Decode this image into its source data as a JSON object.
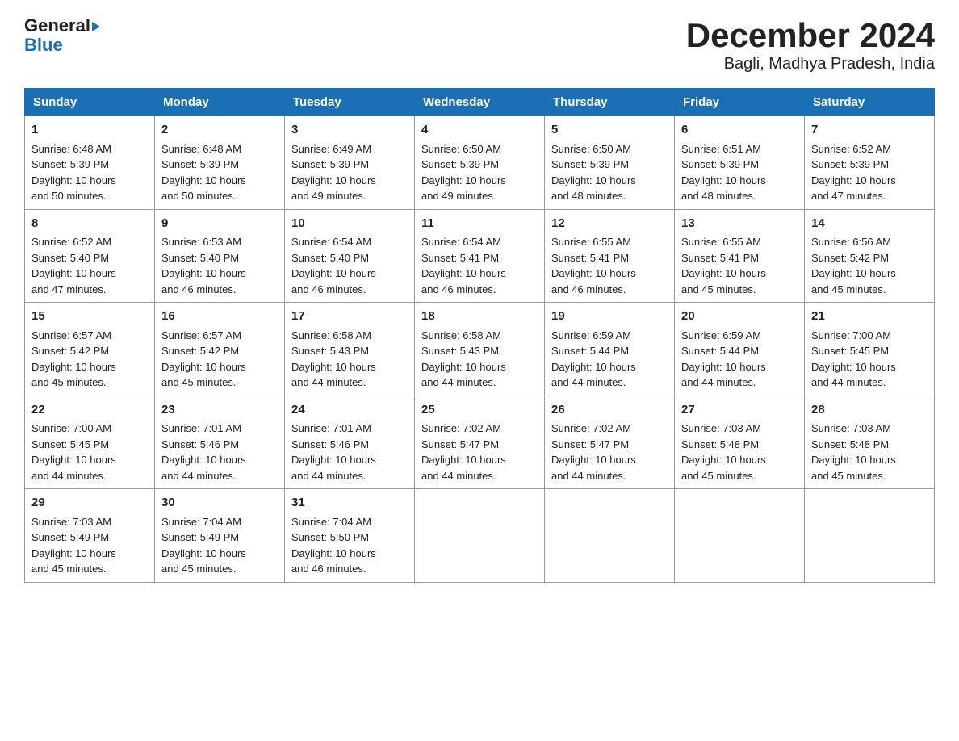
{
  "logo": {
    "general": "General",
    "blue": "Blue"
  },
  "title": "December 2024",
  "subtitle": "Bagli, Madhya Pradesh, India",
  "weekdays": [
    "Sunday",
    "Monday",
    "Tuesday",
    "Wednesday",
    "Thursday",
    "Friday",
    "Saturday"
  ],
  "weeks": [
    [
      {
        "day": "1",
        "sunrise": "6:48 AM",
        "sunset": "5:39 PM",
        "daylight": "10 hours and 50 minutes."
      },
      {
        "day": "2",
        "sunrise": "6:48 AM",
        "sunset": "5:39 PM",
        "daylight": "10 hours and 50 minutes."
      },
      {
        "day": "3",
        "sunrise": "6:49 AM",
        "sunset": "5:39 PM",
        "daylight": "10 hours and 49 minutes."
      },
      {
        "day": "4",
        "sunrise": "6:50 AM",
        "sunset": "5:39 PM",
        "daylight": "10 hours and 49 minutes."
      },
      {
        "day": "5",
        "sunrise": "6:50 AM",
        "sunset": "5:39 PM",
        "daylight": "10 hours and 48 minutes."
      },
      {
        "day": "6",
        "sunrise": "6:51 AM",
        "sunset": "5:39 PM",
        "daylight": "10 hours and 48 minutes."
      },
      {
        "day": "7",
        "sunrise": "6:52 AM",
        "sunset": "5:39 PM",
        "daylight": "10 hours and 47 minutes."
      }
    ],
    [
      {
        "day": "8",
        "sunrise": "6:52 AM",
        "sunset": "5:40 PM",
        "daylight": "10 hours and 47 minutes."
      },
      {
        "day": "9",
        "sunrise": "6:53 AM",
        "sunset": "5:40 PM",
        "daylight": "10 hours and 46 minutes."
      },
      {
        "day": "10",
        "sunrise": "6:54 AM",
        "sunset": "5:40 PM",
        "daylight": "10 hours and 46 minutes."
      },
      {
        "day": "11",
        "sunrise": "6:54 AM",
        "sunset": "5:41 PM",
        "daylight": "10 hours and 46 minutes."
      },
      {
        "day": "12",
        "sunrise": "6:55 AM",
        "sunset": "5:41 PM",
        "daylight": "10 hours and 46 minutes."
      },
      {
        "day": "13",
        "sunrise": "6:55 AM",
        "sunset": "5:41 PM",
        "daylight": "10 hours and 45 minutes."
      },
      {
        "day": "14",
        "sunrise": "6:56 AM",
        "sunset": "5:42 PM",
        "daylight": "10 hours and 45 minutes."
      }
    ],
    [
      {
        "day": "15",
        "sunrise": "6:57 AM",
        "sunset": "5:42 PM",
        "daylight": "10 hours and 45 minutes."
      },
      {
        "day": "16",
        "sunrise": "6:57 AM",
        "sunset": "5:42 PM",
        "daylight": "10 hours and 45 minutes."
      },
      {
        "day": "17",
        "sunrise": "6:58 AM",
        "sunset": "5:43 PM",
        "daylight": "10 hours and 44 minutes."
      },
      {
        "day": "18",
        "sunrise": "6:58 AM",
        "sunset": "5:43 PM",
        "daylight": "10 hours and 44 minutes."
      },
      {
        "day": "19",
        "sunrise": "6:59 AM",
        "sunset": "5:44 PM",
        "daylight": "10 hours and 44 minutes."
      },
      {
        "day": "20",
        "sunrise": "6:59 AM",
        "sunset": "5:44 PM",
        "daylight": "10 hours and 44 minutes."
      },
      {
        "day": "21",
        "sunrise": "7:00 AM",
        "sunset": "5:45 PM",
        "daylight": "10 hours and 44 minutes."
      }
    ],
    [
      {
        "day": "22",
        "sunrise": "7:00 AM",
        "sunset": "5:45 PM",
        "daylight": "10 hours and 44 minutes."
      },
      {
        "day": "23",
        "sunrise": "7:01 AM",
        "sunset": "5:46 PM",
        "daylight": "10 hours and 44 minutes."
      },
      {
        "day": "24",
        "sunrise": "7:01 AM",
        "sunset": "5:46 PM",
        "daylight": "10 hours and 44 minutes."
      },
      {
        "day": "25",
        "sunrise": "7:02 AM",
        "sunset": "5:47 PM",
        "daylight": "10 hours and 44 minutes."
      },
      {
        "day": "26",
        "sunrise": "7:02 AM",
        "sunset": "5:47 PM",
        "daylight": "10 hours and 44 minutes."
      },
      {
        "day": "27",
        "sunrise": "7:03 AM",
        "sunset": "5:48 PM",
        "daylight": "10 hours and 45 minutes."
      },
      {
        "day": "28",
        "sunrise": "7:03 AM",
        "sunset": "5:48 PM",
        "daylight": "10 hours and 45 minutes."
      }
    ],
    [
      {
        "day": "29",
        "sunrise": "7:03 AM",
        "sunset": "5:49 PM",
        "daylight": "10 hours and 45 minutes."
      },
      {
        "day": "30",
        "sunrise": "7:04 AM",
        "sunset": "5:49 PM",
        "daylight": "10 hours and 45 minutes."
      },
      {
        "day": "31",
        "sunrise": "7:04 AM",
        "sunset": "5:50 PM",
        "daylight": "10 hours and 46 minutes."
      },
      null,
      null,
      null,
      null
    ]
  ],
  "labels": {
    "sunrise": "Sunrise:",
    "sunset": "Sunset:",
    "daylight": "Daylight:"
  }
}
